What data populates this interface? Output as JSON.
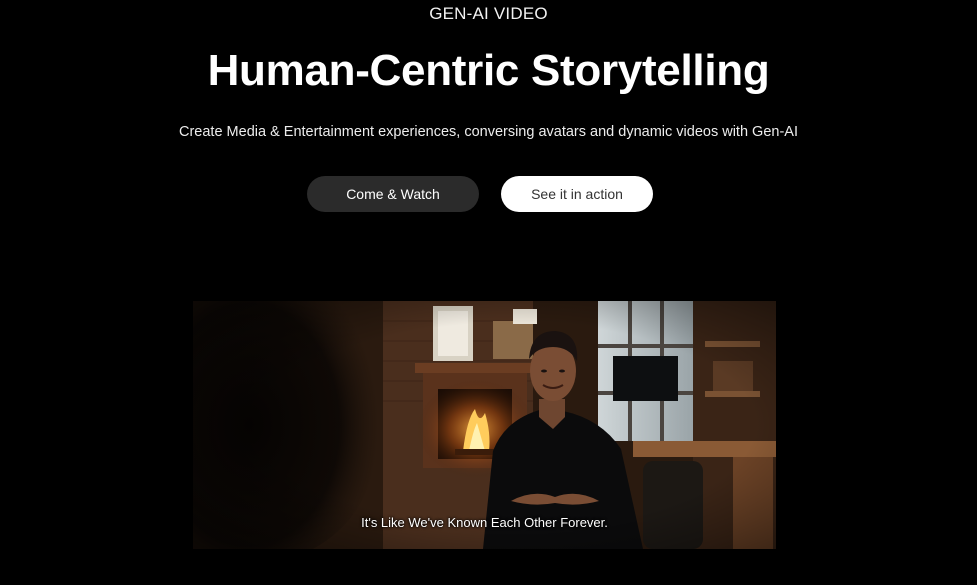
{
  "hero": {
    "eyebrow": "GEN-AI VIDEO",
    "title": "Human-Centric Storytelling",
    "subtitle": "Create Media & Entertainment experiences, conversing avatars and dynamic videos with Gen-AI"
  },
  "actions": {
    "primary_label": "Come & Watch",
    "secondary_label": "See it in action"
  },
  "video": {
    "caption": "It's Like We've Known Each Other Forever."
  },
  "colors": {
    "background": "#000000",
    "primary_button": "#2b2b2b",
    "secondary_button": "#ffffff",
    "text": "#ffffff"
  }
}
